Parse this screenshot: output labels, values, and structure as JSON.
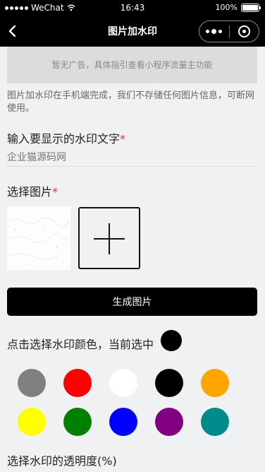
{
  "status_bar": {
    "carrier": "WeChat",
    "time": "16:43",
    "battery": "100%",
    "icons": [
      "signal-icon",
      "wifi-icon",
      "battery-icon"
    ]
  },
  "nav": {
    "title": "图片加水印",
    "icons": [
      "back-icon",
      "more-icon",
      "close-icon"
    ]
  },
  "ad": {
    "text": "暂无广告，具体指引查看小程序流量主功能"
  },
  "notice": "图片加水印在手机端完成，我们不存储任何图片信息，可断网使用。",
  "watermark_text": {
    "label": "输入要显示的水印文字",
    "required_mark": "*",
    "placeholder": "企业猫源码网"
  },
  "image_select": {
    "label": "选择图片",
    "required_mark": "*",
    "add_icon": "plus-icon"
  },
  "generate_button": "生成图片",
  "color_select": {
    "label": "点击选择水印颜色，当前选中",
    "current": "#000000",
    "options": [
      "#808080",
      "#ff0000",
      "#ffffff",
      "#000000",
      "#ffa500",
      "#ffff00",
      "#008000",
      "#0000ff",
      "#800080",
      "#008b8b"
    ]
  },
  "opacity_label": "选择水印的透明度(%)"
}
